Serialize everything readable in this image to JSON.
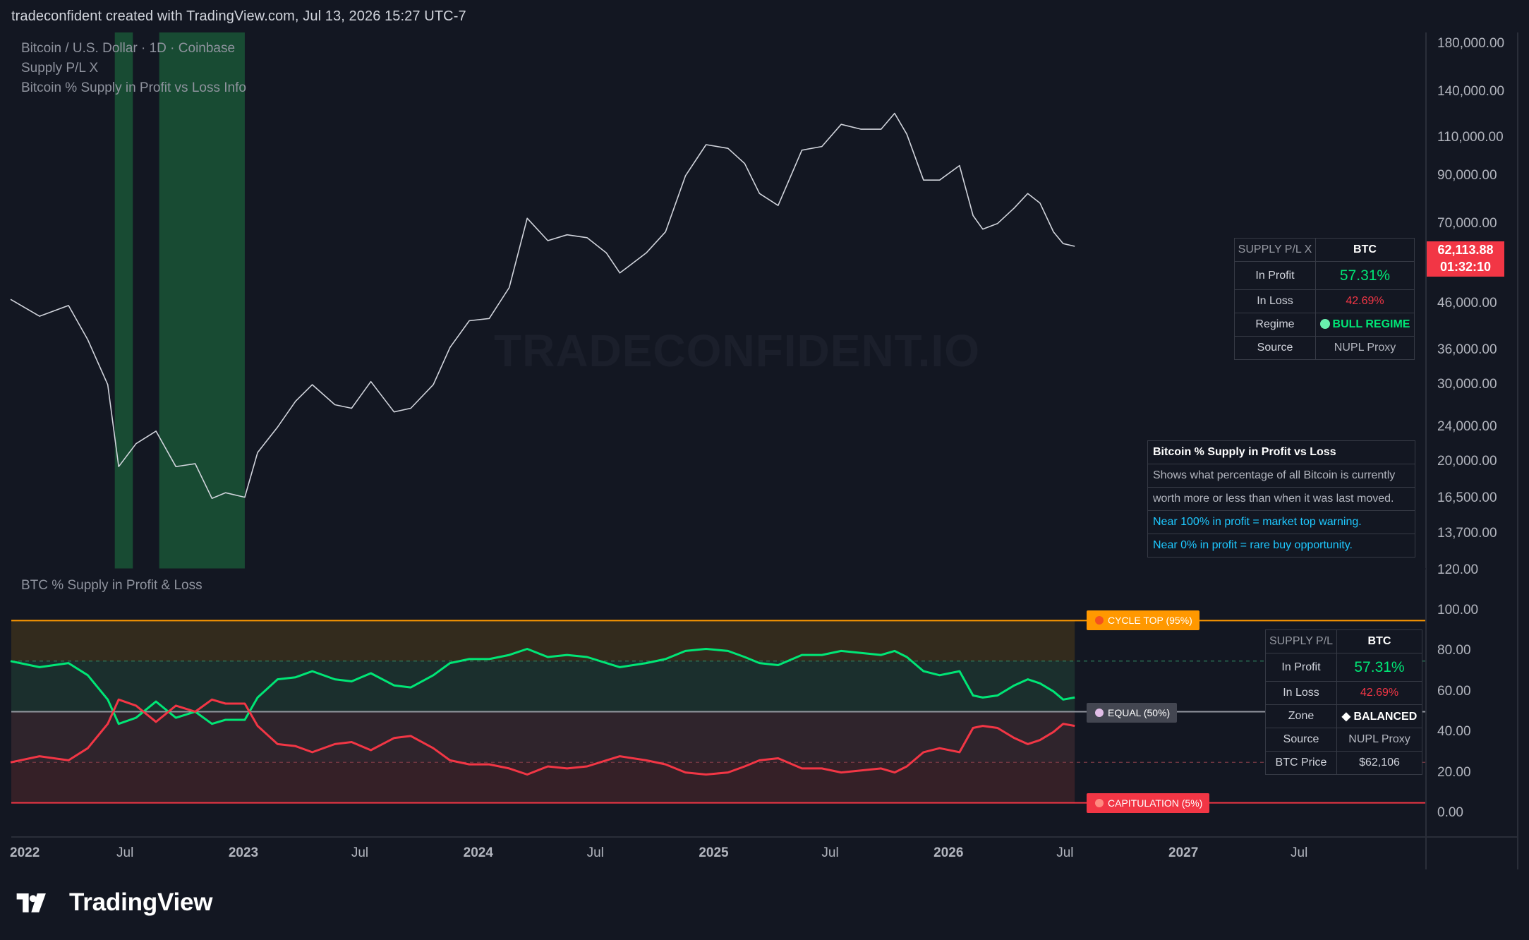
{
  "header": {
    "attribution": "tradeconfident created with TradingView.com, Jul 13, 2026 15:27 UTC-7"
  },
  "watermark": "TRADECONFIDENT.IO",
  "main_pane": {
    "legend": {
      "symbol": "Bitcoin / U.S. Dollar · 1D · Coinbase",
      "indicator_1": "Supply P/L X",
      "indicator_2": "Bitcoin % Supply in Profit vs Loss Info"
    },
    "y_axis_labels": [
      "180,000.00",
      "140,000.00",
      "110,000.00",
      "90,000.00",
      "70,000.00",
      "46,000.00",
      "36,000.00",
      "30,000.00",
      "24,000.00",
      "20,000.00",
      "16,500.00",
      "13,700.00"
    ],
    "last_price": "62,113.88",
    "countdown": "01:32:10",
    "info_table": {
      "header_left": "SUPPLY P/L X",
      "header_right": "BTC",
      "rows": [
        {
          "label": "In Profit",
          "value": "57.31%"
        },
        {
          "label": "In Loss",
          "value": "42.69%"
        },
        {
          "label": "Regime",
          "value": "BULL REGIME"
        },
        {
          "label": "Source",
          "value": "NUPL Proxy"
        }
      ]
    },
    "info_box": {
      "title": "Bitcoin % Supply in Profit vs Loss",
      "line1": "Shows what percentage of all Bitcoin is currently",
      "line2": "worth more or less than when it was last moved.",
      "line3": "Near 100% in profit = market top warning.",
      "line4": "Near 0% in profit = rare buy opportunity."
    }
  },
  "lower_pane": {
    "title": "BTC % Supply in Profit & Loss",
    "y_axis_labels": [
      "120.00",
      "100.00",
      "80.00",
      "60.00",
      "40.00",
      "20.00",
      "0.00"
    ],
    "labels": {
      "cycle_top": "CYCLE TOP (95%)",
      "equal": "EQUAL (50%)",
      "capitulation": "CAPITULATION (5%)"
    },
    "table": {
      "header_left": "SUPPLY P/L",
      "header_right": "BTC",
      "rows": [
        {
          "label": "In Profit",
          "value": "57.31%"
        },
        {
          "label": "In Loss",
          "value": "42.69%"
        },
        {
          "label": "Zone",
          "value": "◆ BALANCED"
        },
        {
          "label": "Source",
          "value": "NUPL Proxy"
        },
        {
          "label": "BTC Price",
          "value": "$62,106"
        }
      ]
    }
  },
  "x_axis_labels": [
    "2022",
    "Jul",
    "2023",
    "Jul",
    "2024",
    "Jul",
    "2025",
    "Jul",
    "2026",
    "Jul",
    "2027",
    "Jul"
  ],
  "footer": {
    "brand": "TradingView"
  },
  "colors": {
    "background": "#131722",
    "price_line": "#d1d4dc",
    "profit": "#00e676",
    "loss": "#f23645",
    "cycle_top": "#ff9800",
    "capitulation": "#f23645",
    "highlight_band": "#1b5e3a"
  },
  "chart_data": [
    {
      "type": "line",
      "title": "Bitcoin / U.S. Dollar · 1D · Coinbase",
      "y_scale": "log",
      "ylim": [
        12500,
        185000
      ],
      "x": [
        "2022-01-01",
        "2022-02-15",
        "2022-04-01",
        "2022-05-01",
        "2022-06-01",
        "2022-06-18",
        "2022-07-15",
        "2022-08-15",
        "2022-09-15",
        "2022-10-15",
        "2022-11-10",
        "2022-12-01",
        "2022-12-31",
        "2023-01-20",
        "2023-02-20",
        "2023-03-20",
        "2023-04-15",
        "2023-05-20",
        "2023-06-15",
        "2023-07-15",
        "2023-08-20",
        "2023-09-15",
        "2023-10-20",
        "2023-11-15",
        "2023-12-15",
        "2024-01-15",
        "2024-02-15",
        "2024-03-14",
        "2024-04-15",
        "2024-05-15",
        "2024-06-15",
        "2024-07-15",
        "2024-08-05",
        "2024-09-15",
        "2024-10-15",
        "2024-11-15",
        "2024-12-17",
        "2025-01-20",
        "2025-02-15",
        "2025-03-10",
        "2025-04-08",
        "2025-05-15",
        "2025-06-15",
        "2025-07-15",
        "2025-08-15",
        "2025-09-15",
        "2025-10-06",
        "2025-10-25",
        "2025-11-20",
        "2025-12-15",
        "2026-01-15",
        "2026-02-05",
        "2026-02-20",
        "2026-03-15",
        "2026-04-10",
        "2026-05-01",
        "2026-05-20",
        "2026-06-10",
        "2026-06-25",
        "2026-07-13"
      ],
      "series": [
        {
          "values": [
            47000,
            43000,
            45500,
            38000,
            30000,
            19500,
            22000,
            23500,
            19500,
            19800,
            16500,
            17000,
            16600,
            21000,
            24000,
            27500,
            30000,
            27000,
            26500,
            30500,
            26000,
            26500,
            30000,
            36500,
            42000,
            42500,
            50000,
            72000,
            64000,
            66000,
            65000,
            60000,
            54000,
            60000,
            67000,
            90000,
            106000,
            104000,
            96000,
            82000,
            77000,
            103000,
            105000,
            118000,
            115000,
            115000,
            125000,
            112000,
            88000,
            88000,
            95000,
            73000,
            68000,
            70000,
            76000,
            82000,
            78000,
            67000,
            63000,
            62114
          ]
        }
      ],
      "highlight_periods": [
        [
          "2022-06-12",
          "2022-07-10"
        ],
        [
          "2022-08-20",
          "2022-12-31"
        ]
      ]
    },
    {
      "type": "line",
      "title": "BTC % Supply in Profit & Loss",
      "ylim": [
        -5,
        120
      ],
      "reference_lines": [
        {
          "name": "CYCLE TOP (95%)",
          "value": 95
        },
        {
          "name": "EQUAL (50%)",
          "value": 50
        },
        {
          "name": "CAPITULATION (5%)",
          "value": 5
        }
      ],
      "x": [
        "2022-01-01",
        "2022-02-15",
        "2022-04-01",
        "2022-05-01",
        "2022-06-01",
        "2022-06-18",
        "2022-07-15",
        "2022-08-15",
        "2022-09-15",
        "2022-10-15",
        "2022-11-10",
        "2022-12-01",
        "2022-12-31",
        "2023-01-20",
        "2023-02-20",
        "2023-03-20",
        "2023-04-15",
        "2023-05-20",
        "2023-06-15",
        "2023-07-15",
        "2023-08-20",
        "2023-09-15",
        "2023-10-20",
        "2023-11-15",
        "2023-12-15",
        "2024-01-15",
        "2024-02-15",
        "2024-03-14",
        "2024-04-15",
        "2024-05-15",
        "2024-06-15",
        "2024-07-15",
        "2024-08-05",
        "2024-09-15",
        "2024-10-15",
        "2024-11-15",
        "2024-12-17",
        "2025-01-20",
        "2025-02-15",
        "2025-03-10",
        "2025-04-08",
        "2025-05-15",
        "2025-06-15",
        "2025-07-15",
        "2025-08-15",
        "2025-09-15",
        "2025-10-06",
        "2025-10-25",
        "2025-11-20",
        "2025-12-15",
        "2026-01-15",
        "2026-02-05",
        "2026-02-20",
        "2026-03-15",
        "2026-04-10",
        "2026-05-01",
        "2026-05-20",
        "2026-06-10",
        "2026-06-25",
        "2026-07-13"
      ],
      "series": [
        {
          "name": "In Profit",
          "values": [
            75,
            72,
            74,
            68,
            56,
            44,
            47,
            55,
            47,
            50,
            44,
            46,
            46,
            57,
            66,
            67,
            70,
            66,
            65,
            69,
            63,
            62,
            68,
            74,
            76,
            76,
            78,
            81,
            77,
            78,
            77,
            74,
            72,
            74,
            76,
            80,
            81,
            80,
            77,
            74,
            73,
            78,
            78,
            80,
            79,
            78,
            80,
            77,
            70,
            68,
            70,
            58,
            57,
            58,
            63,
            66,
            64,
            60,
            56,
            57
          ]
        },
        {
          "name": "In Loss",
          "values": [
            25,
            28,
            26,
            32,
            44,
            56,
            53,
            45,
            53,
            50,
            56,
            54,
            54,
            43,
            34,
            33,
            30,
            34,
            35,
            31,
            37,
            38,
            32,
            26,
            24,
            24,
            22,
            19,
            23,
            22,
            23,
            26,
            28,
            26,
            24,
            20,
            19,
            20,
            23,
            26,
            27,
            22,
            22,
            20,
            21,
            22,
            20,
            23,
            30,
            32,
            30,
            42,
            43,
            42,
            37,
            34,
            36,
            40,
            44,
            43
          ]
        }
      ]
    }
  ]
}
